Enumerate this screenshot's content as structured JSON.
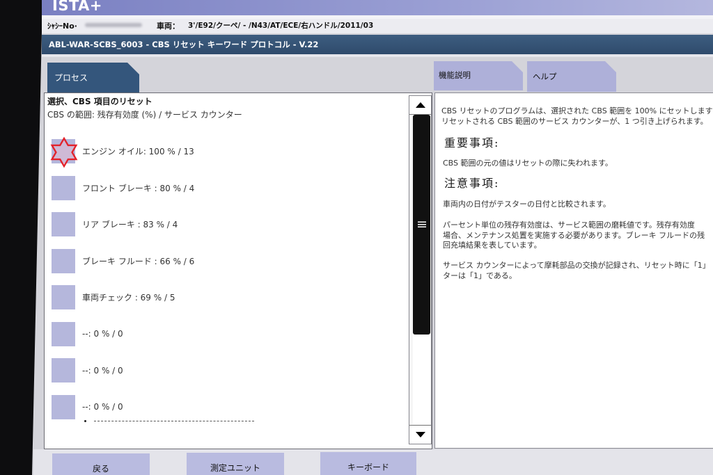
{
  "app": {
    "title": "ISTA+"
  },
  "vehicle_info": {
    "chassis_label": "ｼｬｼｰNo·",
    "vehicle_label": "車両：",
    "vehicle_value": "3'/E92/クーペ/ - /N43/AT/ECE/右ハンドル/2011/03"
  },
  "procedure": {
    "title": "ABL-WAR-SCBS_6003 - CBS リセット キーワード プロトコル - V.22"
  },
  "tabs": {
    "process": "プロセス",
    "function_description": "機能説明",
    "help": "ヘルプ"
  },
  "process": {
    "heading": "選択、CBS 項目のリセット",
    "subheading": "CBS の範囲: 残存有効度 (%) / サービス カウンター",
    "items": [
      {
        "label": "エンジン オイル: 100 % / 13",
        "icon": "red-star-icon"
      },
      {
        "label": "フロント ブレーキ : 80 % / 4"
      },
      {
        "label": "リア ブレーキ : 83 % / 4"
      },
      {
        "label": "ブレーキ フルード : 66 % / 6"
      },
      {
        "label": "車両チェック : 69 % / 5"
      },
      {
        "label": "--: 0 % / 0"
      },
      {
        "label": "--: 0 % / 0"
      },
      {
        "label": "--: 0 % / 0"
      }
    ],
    "scrollbar": {
      "position_percent": 0,
      "visible_percent": 71
    }
  },
  "help_text": {
    "intro": [
      "CBS リセットのプログラムは、選択された CBS 範囲を 100% にセットします",
      "リセットされる CBS 範囲のサービス カウンターが、1 つ引き上げられます。"
    ],
    "important_heading": "重要事項:",
    "important": [
      "CBS 範囲の元の値はリセットの際に失われます。"
    ],
    "notes_heading": "注意事項:",
    "notes": [
      [
        "車両内の日付がテスターの日付と比較されます。"
      ],
      [
        "パーセント単位の残存有効度は、サービス範囲の磨耗値です。残存有効度",
        "場合、メンテナンス処置を実施する必要があります。ブレーキ フルードの残",
        "回充填結果を表しています。"
      ],
      [
        "サービス カウンターによって摩耗部品の交換が記録され、リセット時に「1」",
        "ターは「1」である。"
      ]
    ]
  },
  "footer": {
    "back": "戻る",
    "measuring_unit": "測定ユニット",
    "keyboard": "キーボード"
  },
  "colors": {
    "title_bar": "#7a80c2",
    "procedure_bar": "#2f4b6c",
    "tab_active": "#34567c",
    "tab_inactive": "#aeb0d9",
    "item_box": "#b5b7dc",
    "marker": "#e3232b",
    "button": "#b9bbe0"
  }
}
